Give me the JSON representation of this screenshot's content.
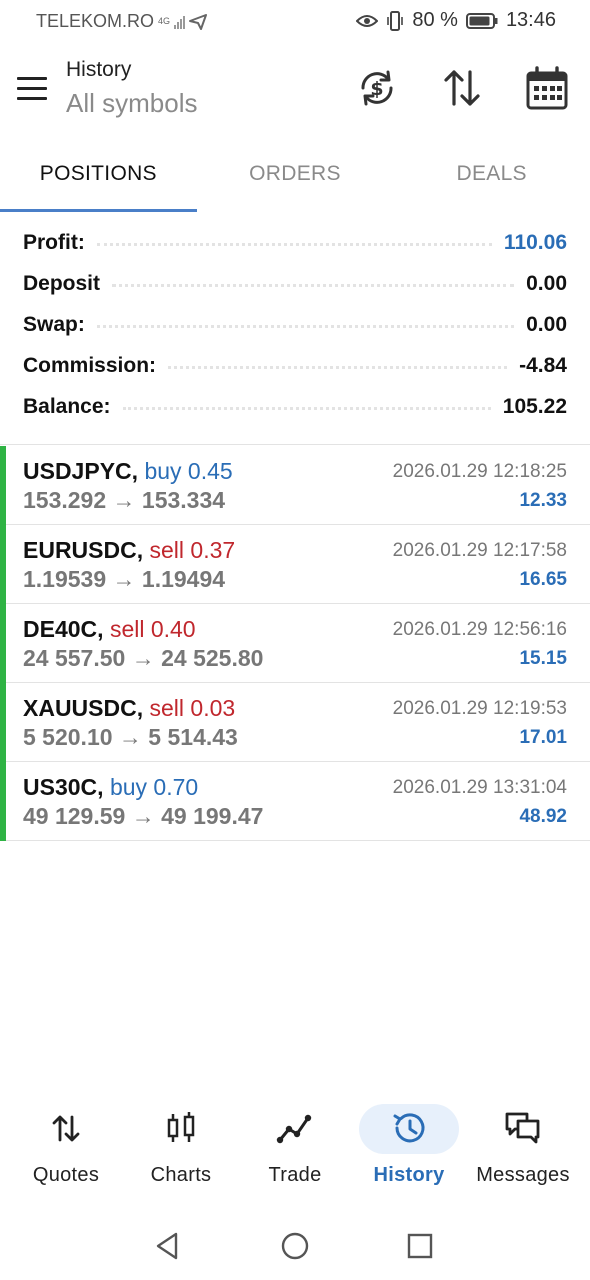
{
  "status_bar": {
    "carrier": "TELEKOM.RO",
    "network": "4G",
    "battery": "80 %",
    "time": "13:46"
  },
  "header": {
    "title": "History",
    "subtitle": "All symbols"
  },
  "tabs": [
    {
      "label": "POSITIONS",
      "active": true
    },
    {
      "label": "ORDERS",
      "active": false
    },
    {
      "label": "DEALS",
      "active": false
    }
  ],
  "summary": [
    {
      "label": "Profit:",
      "value": "110.06"
    },
    {
      "label": "Deposit",
      "value": "0.00"
    },
    {
      "label": "Swap:",
      "value": "0.00"
    },
    {
      "label": "Commission:",
      "value": "-4.84"
    },
    {
      "label": "Balance:",
      "value": "105.22"
    }
  ],
  "positions": [
    {
      "symbol": "USDJPYC,",
      "side": "buy 0.45",
      "prices": "153.292 → 153.334",
      "time": "2026.01.29 12:18:25",
      "profit": "12.33"
    },
    {
      "symbol": "EURUSDC,",
      "side": "sell 0.37",
      "prices": "1.19539 → 1.19494",
      "time": "2026.01.29 12:17:58",
      "profit": "16.65"
    },
    {
      "symbol": "DE40C,",
      "side": "sell 0.40",
      "prices": "24 557.50 → 24 525.80",
      "time": "2026.01.29 12:56:16",
      "profit": "15.15"
    },
    {
      "symbol": "XAUUSDC,",
      "side": "sell 0.03",
      "prices": "5 520.10 → 5 514.43",
      "time": "2026.01.29 12:19:53",
      "profit": "17.01"
    },
    {
      "symbol": "US30C,",
      "side": "buy 0.70",
      "prices": "49 129.59 → 49 199.47",
      "time": "2026.01.29 13:31:04",
      "profit": "48.92"
    }
  ],
  "bottom_nav": [
    {
      "label": "Quotes",
      "icon": "quotes-arrows-icon"
    },
    {
      "label": "Charts",
      "icon": "candlestick-icon"
    },
    {
      "label": "Trade",
      "icon": "trend-line-icon"
    },
    {
      "label": "History",
      "icon": "clock-history-icon",
      "active": true
    },
    {
      "label": "Messages",
      "icon": "chat-bubbles-icon"
    }
  ],
  "colors": {
    "accent": "#2a6db6",
    "sell": "#c0272d",
    "position_bar": "#2fb344",
    "tab_underline": "#4a7fc8"
  }
}
